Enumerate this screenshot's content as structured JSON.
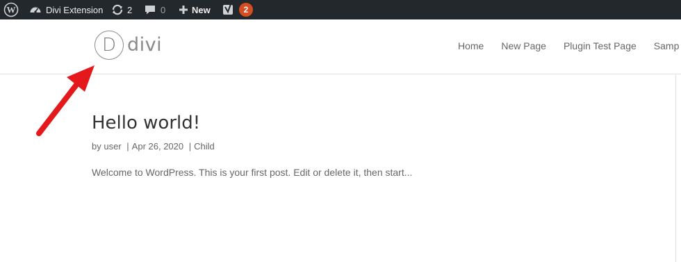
{
  "admin_bar": {
    "site_name": "Divi Extension",
    "updates_count": "2",
    "comments_count": "0",
    "new_label": "New",
    "yoast_badge": "2",
    "icons": {
      "wp": "wordpress-logo-icon",
      "site": "dashboard-icon",
      "updates": "updates-icon",
      "comments": "comment-icon",
      "new": "plus-icon",
      "yoast": "yoast-icon"
    }
  },
  "header": {
    "logo_letter": "D",
    "logo_text": "divi",
    "nav": [
      "Home",
      "New Page",
      "Plugin Test Page",
      "Samp"
    ]
  },
  "post": {
    "title": "Hello world!",
    "meta_by": "by",
    "author": "user",
    "date": "Apr 26, 2020",
    "category": "Child",
    "separator": "|",
    "excerpt": "Welcome to WordPress. This is your first post. Edit or delete it, then start..."
  },
  "colors": {
    "admin_bar_bg": "#23282d",
    "badge": "#d54e21",
    "arrow": "#e3191c",
    "text": "#666666",
    "title": "#333333"
  }
}
